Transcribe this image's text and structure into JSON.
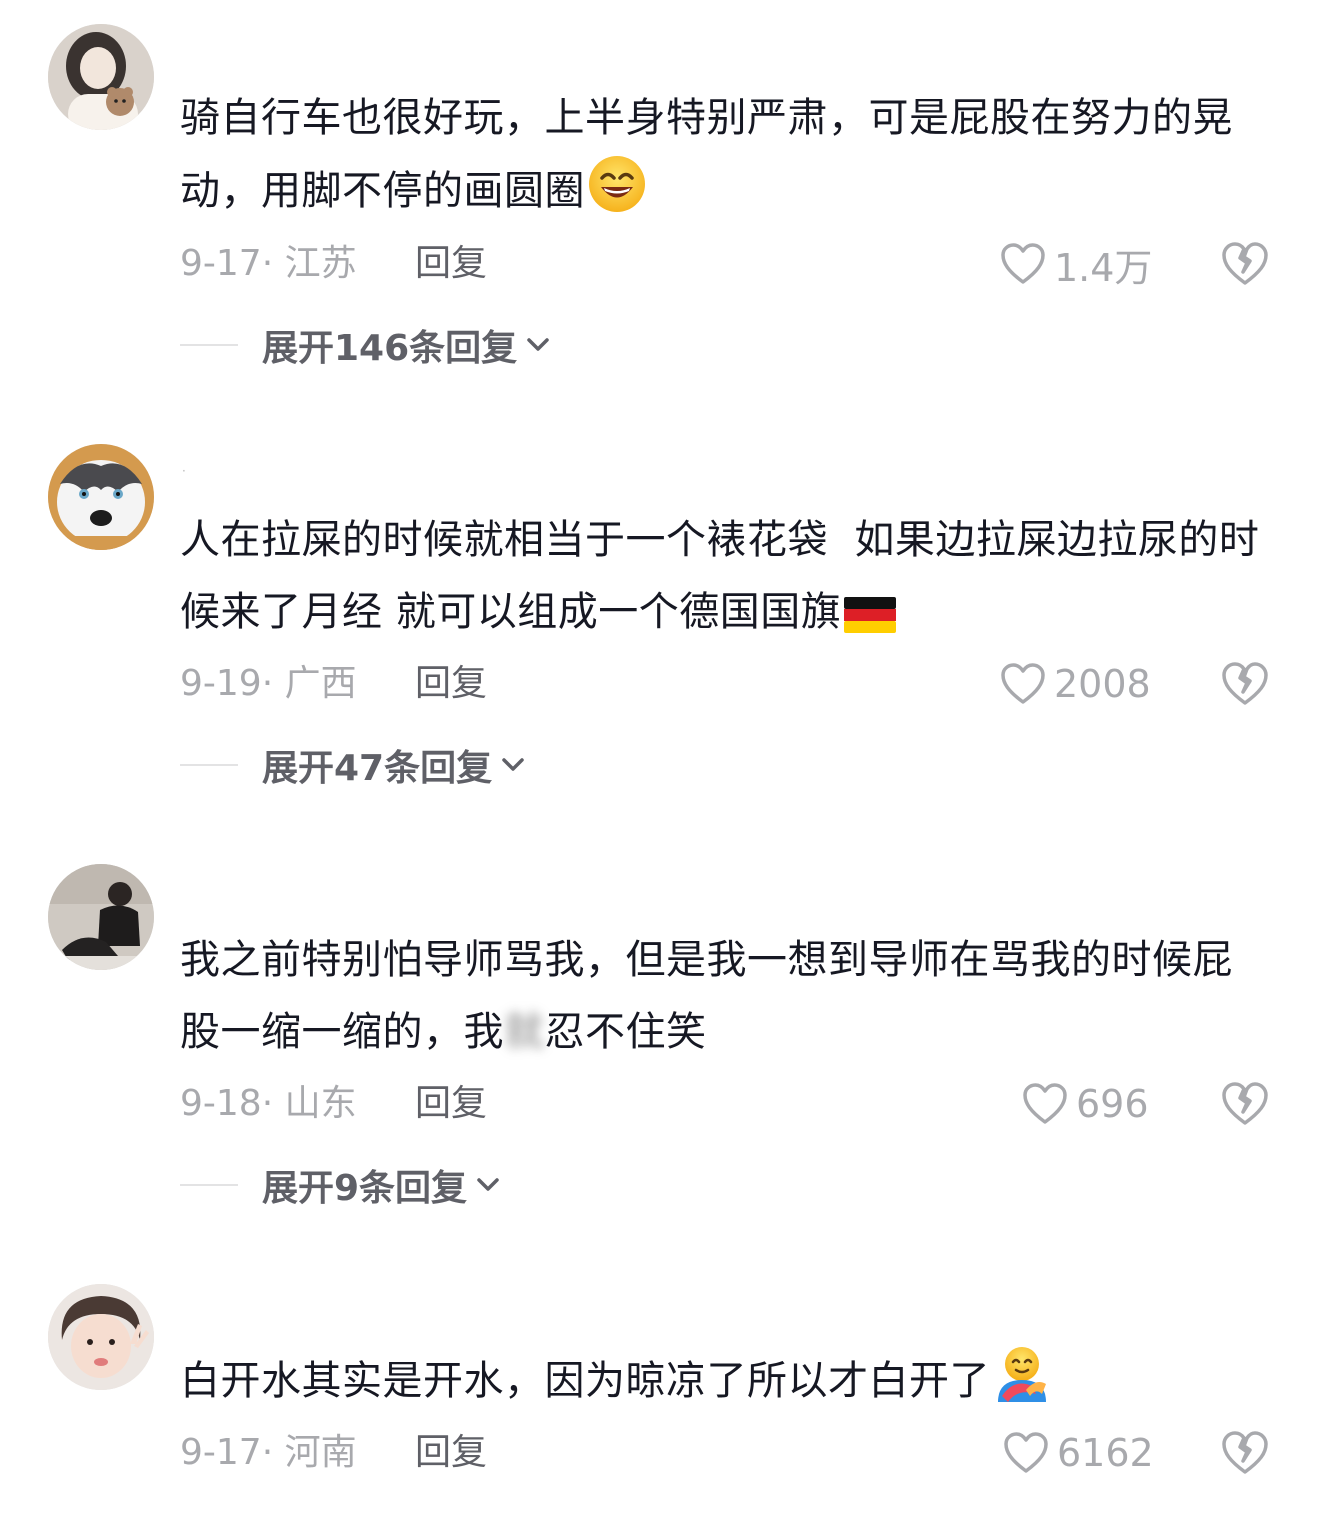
{
  "comments": [
    {
      "user": "",
      "text": "骑自行车也很好玩，上半身特别严肃，可是屁股在努力的晃动，用脚不停的画圆圈",
      "emoji": "grinning-squint-emoji",
      "date": "9-17",
      "location": "江苏",
      "reply": "回复",
      "likes": "1.4万",
      "expand": "展开146条回复"
    },
    {
      "user": "·",
      "text": "人在拉屎的时候就相当于一个裱花袋  如果边拉屎边拉尿的时候来了月经 就可以组成一个德国国旗",
      "emoji": "germany-flag-emoji",
      "date": "9-19",
      "location": "广西",
      "reply": "回复",
      "likes": "2008",
      "expand": "展开47条回复"
    },
    {
      "user": "",
      "text_before": "我之前特别怕导师骂我，但是我一想到导师在骂我的时候屁股一缩一缩的，我",
      "text_blur": "就",
      "text_after": "忍不住笑",
      "date": "9-18",
      "location": "山东",
      "reply": "回复",
      "likes": "696",
      "expand": "展开9条回复"
    },
    {
      "user": "",
      "text": "白开水其实是开水，因为晾凉了所以才白开了",
      "emoji": "hugging-emoji",
      "date": "9-17",
      "location": "河南",
      "reply": "回复",
      "likes": "6162"
    }
  ],
  "colors": {
    "text": "#161823",
    "meta": "#a8a9ad",
    "reply": "#5f6067",
    "divider": "#e3e3e4"
  }
}
